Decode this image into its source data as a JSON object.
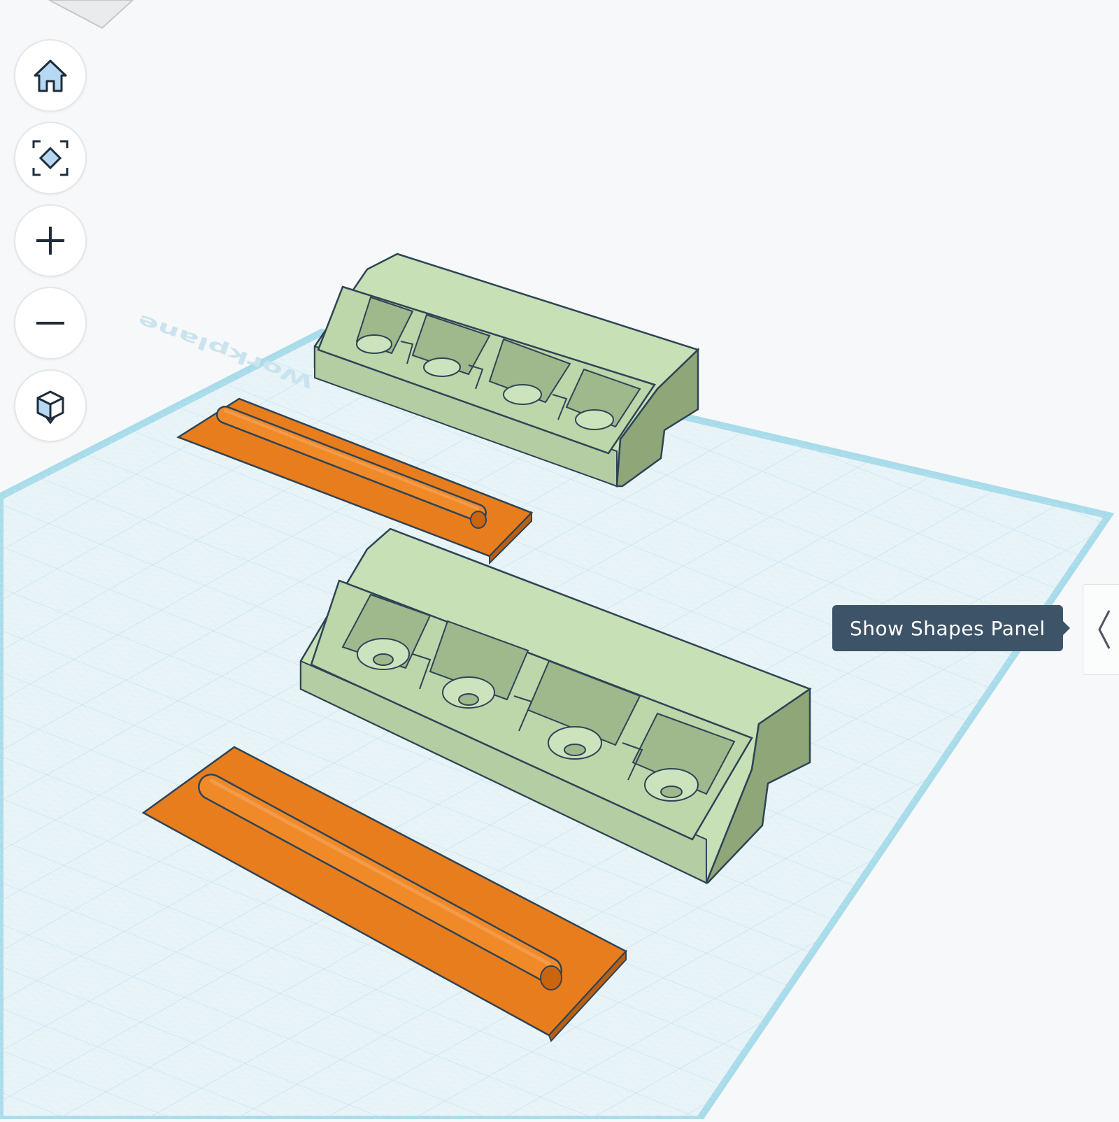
{
  "tooltip": {
    "text": "Show Shapes Panel"
  },
  "workplane": {
    "label": "Workplane"
  },
  "nav": {
    "items": [
      {
        "name": "home-view-button",
        "icon": "home-icon"
      },
      {
        "name": "fit-view-button",
        "icon": "fit-selection-icon"
      },
      {
        "name": "zoom-in-button",
        "icon": "plus-icon"
      },
      {
        "name": "zoom-out-button",
        "icon": "minus-icon"
      },
      {
        "name": "projection-toggle-button",
        "icon": "cube-view-icon"
      }
    ]
  },
  "colors": {
    "canvas": "#f7f8f9",
    "grid_fill": "#e8f3f7",
    "grid_line": "#c5e2ec",
    "grid_border": "#a9dcea",
    "part_green": "#c8e0b6",
    "part_green_dark": "#a9c496",
    "part_orange": "#e87d1e",
    "outline": "#2e4456",
    "tooltip_bg": "#3d5468"
  }
}
